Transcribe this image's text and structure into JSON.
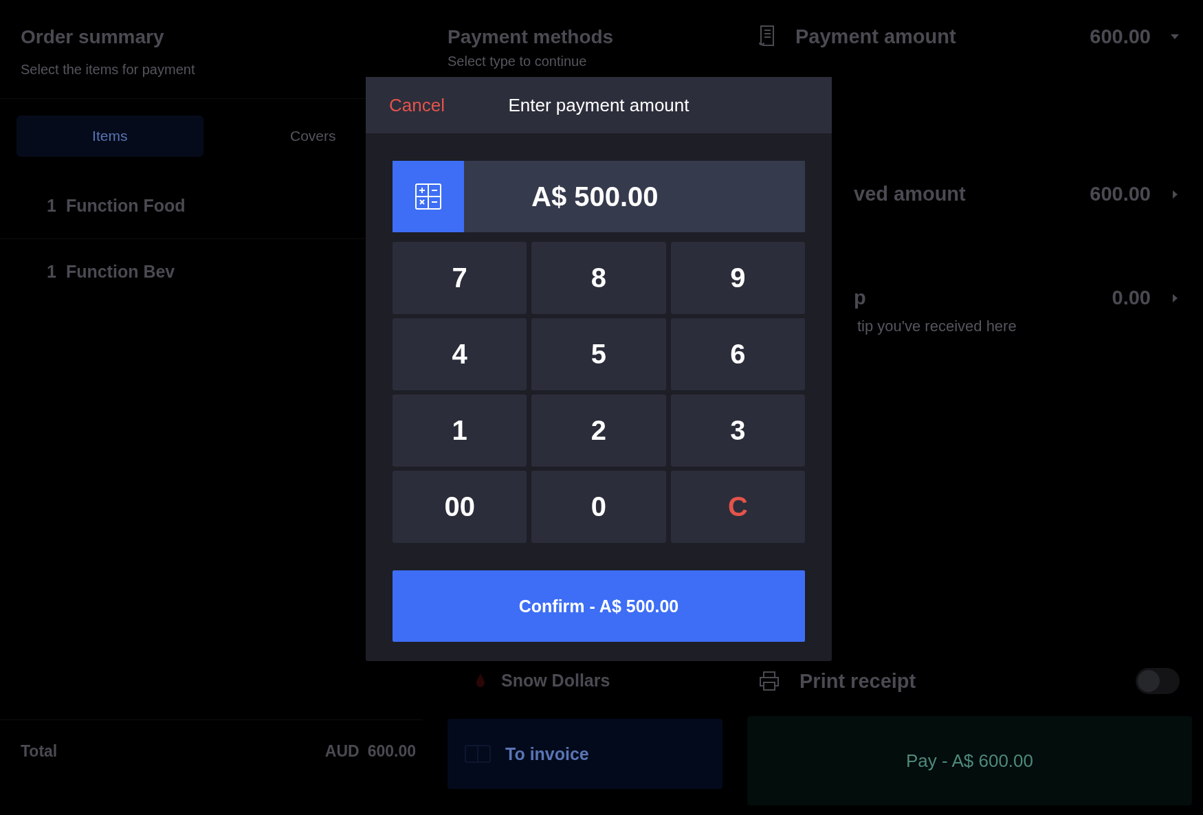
{
  "order_summary": {
    "title": "Order summary",
    "subtitle": "Select the items for payment",
    "tabs": [
      {
        "label": "Items",
        "selected": true
      },
      {
        "label": "Covers",
        "selected": false
      }
    ],
    "items": [
      {
        "qty": "1",
        "name": "Function Food"
      },
      {
        "qty": "1",
        "name": "Function Bev"
      }
    ],
    "total": {
      "label": "Total",
      "currency": "AUD",
      "amount": "600.00"
    }
  },
  "payment_methods": {
    "title": "Payment methods",
    "subtitle": "Select type to continue",
    "methods": [
      {
        "name": "Snow Dollars"
      }
    ],
    "invoice_button": "To invoice"
  },
  "payment": {
    "amount": {
      "label": "Payment amount",
      "value": "600.00"
    },
    "received": {
      "label": "ved amount",
      "value": "600.00"
    },
    "tip": {
      "label": "p",
      "value": "0.00",
      "hint": "tip you've received here"
    },
    "print_receipt": {
      "label": "Print receipt",
      "on": false
    },
    "pay_button": "Pay - A$ 600.00"
  },
  "modal": {
    "cancel": "Cancel",
    "title": "Enter payment amount",
    "amount": "A$ 500.00",
    "keys": [
      {
        "label": "7",
        "kind": "digit"
      },
      {
        "label": "8",
        "kind": "digit"
      },
      {
        "label": "9",
        "kind": "digit"
      },
      {
        "label": "4",
        "kind": "digit"
      },
      {
        "label": "5",
        "kind": "digit"
      },
      {
        "label": "6",
        "kind": "digit"
      },
      {
        "label": "1",
        "kind": "digit"
      },
      {
        "label": "2",
        "kind": "digit"
      },
      {
        "label": "3",
        "kind": "digit"
      },
      {
        "label": "00",
        "kind": "digit"
      },
      {
        "label": "0",
        "kind": "digit"
      },
      {
        "label": "C",
        "kind": "clear"
      }
    ],
    "confirm": "Confirm - A$ 500.00"
  }
}
